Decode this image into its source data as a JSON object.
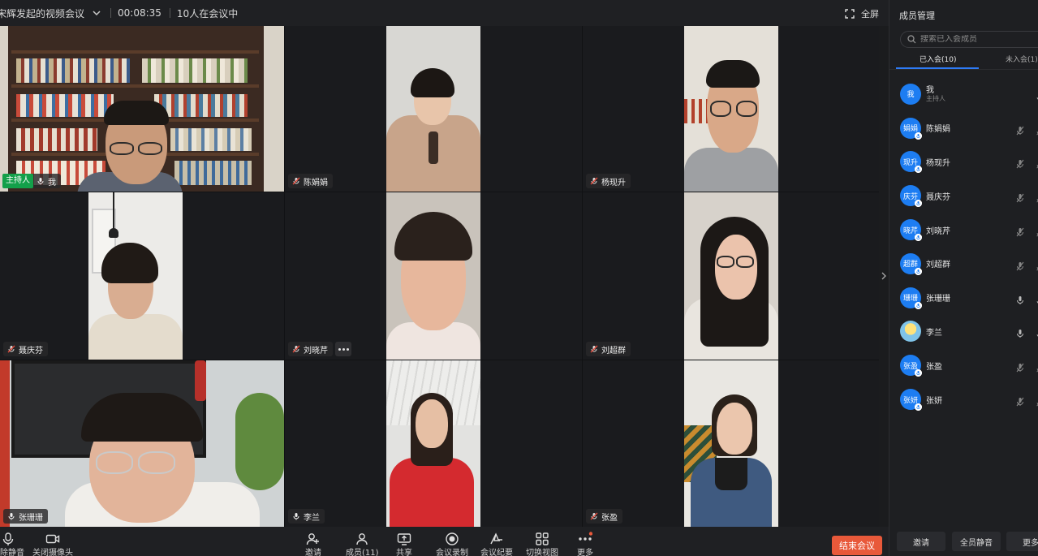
{
  "topbar": {
    "meeting_title": "宋辉发起的视频会议",
    "elapsed": "00:08:35",
    "participants_status": "10人在会议中",
    "fullscreen_label": "全屏"
  },
  "tiles": [
    {
      "name": "我",
      "host_label": "主持人",
      "muted": false
    },
    {
      "name": "陈娟娟",
      "muted": true
    },
    {
      "name": "杨现升",
      "muted": true
    },
    {
      "name": "聂庆芬",
      "muted": true
    },
    {
      "name": "刘晓芹",
      "muted": true
    },
    {
      "name": "刘超群",
      "muted": true
    },
    {
      "name": "张珊珊",
      "muted": false
    },
    {
      "name": "李兰",
      "muted": false
    },
    {
      "name": "张盈",
      "muted": true
    }
  ],
  "toolbar": {
    "unmute_label": "解除静音",
    "camera_label": "关闭摄像头",
    "invite_label": "邀请",
    "members_label": "成员(11)",
    "share_label": "共享",
    "record_label": "会议录制",
    "minutes_label": "会议纪要",
    "layout_label": "切换视图",
    "more_label": "更多",
    "end_label": "结束会议"
  },
  "panel": {
    "title": "成员管理",
    "search_placeholder": "搜索已入会成员",
    "tab_joined": "已入会(10)",
    "tab_not_joined": "未入会(1)",
    "members": [
      {
        "avatar": "我",
        "name": "我",
        "role": "主持人",
        "mic": "none"
      },
      {
        "avatar": "娟娟",
        "name": "陈娟娟",
        "mic": "muted"
      },
      {
        "avatar": "现升",
        "name": "杨现升",
        "mic": "muted"
      },
      {
        "avatar": "庆芬",
        "name": "聂庆芬",
        "mic": "muted"
      },
      {
        "avatar": "晓芹",
        "name": "刘晓芹",
        "mic": "muted"
      },
      {
        "avatar": "超群",
        "name": "刘超群",
        "mic": "muted"
      },
      {
        "avatar": "珊珊",
        "name": "张珊珊",
        "mic": "on"
      },
      {
        "avatar": "",
        "name": "李兰",
        "mic": "on"
      },
      {
        "avatar": "张盈",
        "name": "张盈",
        "mic": "muted"
      },
      {
        "avatar": "张妍",
        "name": "张妍",
        "mic": "muted"
      }
    ],
    "btn_invite": "邀请",
    "btn_mute_all": "全员静音",
    "btn_more": "更多"
  },
  "colors": {
    "accent": "#1d7df2",
    "end_button": "#e8593a",
    "host_badge": "#13a04a",
    "muted_red": "#e64a3b"
  }
}
